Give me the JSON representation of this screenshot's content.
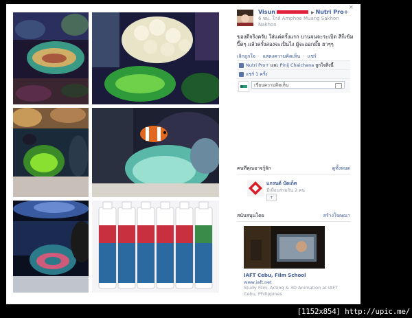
{
  "post": {
    "author_prefix": "Visun",
    "author_suffix": "Nutri Pro+",
    "meta": "6 ชม. ใกล้ Amphoe Muang Sakhon Nakhon",
    "caption": "ของดีจริงครับ ใส่แค่ครั้งแรก บานจนจะระเบิด สีก็เข้ม ปี๊ดๆ แล้วครั้งสองจะเป็นไง ผู้จะออกมั๊ย ฮาๆๆ",
    "actions": [
      "เลิกถูกใจ",
      "แสดงความคิดเห็น",
      "แชร์"
    ],
    "likes_link1": "Nutri Pro+",
    "likes_mid": " และ ",
    "likes_link2": "Pinij Chaichana",
    "likes_suffix": " ถูกใจสิ่งนี้",
    "shares": "แชร์ 1 ครั้ง",
    "comment_placeholder": "เขียนความคิดเห็น",
    "close": "×"
  },
  "pymk": {
    "heading": "คนที่คุณอาจรู้จัก",
    "see_all": "ดูทั้งหมด",
    "name": "แกรนด์ บัดเก็ต",
    "mutual": "มีเพื่อนร่วมกัน 2 คน",
    "add": "+"
  },
  "sponsored": {
    "heading": "สนับสนุนโดย",
    "create_ad": "สร้างโฆษณา",
    "title": "IAFT Cebu, Film School",
    "url": "www.iaft.net",
    "description": "Study Film, Acting & 3D Animation at IAFT Cebu, Philippines"
  },
  "stamp": "[1152x854] http://upic.me/",
  "colors": {
    "link": "#3b5998",
    "redaction": "#e0233a",
    "background": "#000000"
  },
  "icons": [
    "close-icon",
    "like-icon",
    "share-icon",
    "camera-icon",
    "add-friend-icon"
  ]
}
